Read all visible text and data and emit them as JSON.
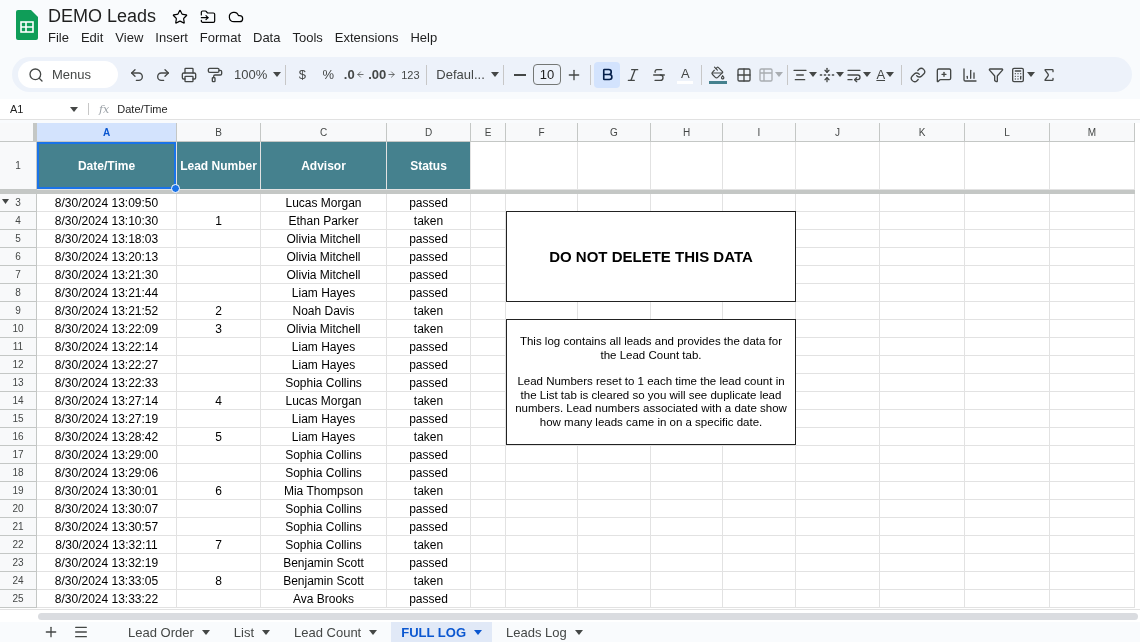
{
  "document": {
    "title": "DEMO Leads"
  },
  "menu": [
    "File",
    "Edit",
    "View",
    "Insert",
    "Format",
    "Data",
    "Tools",
    "Extensions",
    "Help"
  ],
  "toolbar": {
    "search_placeholder": "Menus",
    "zoom": "100%",
    "currency": "$",
    "percent": "%",
    "decrease_decimal": ".0",
    "increase_decimal": ".00",
    "number_format": "123",
    "font": "Defaul...",
    "font_size": "10",
    "bold_selected": true,
    "text_color_glyph": "A",
    "text_rotation_glyph": "A"
  },
  "function_glyph": "fx",
  "name_box": "A1",
  "formula": "Date/Time",
  "columns": [
    {
      "label": "A",
      "selected": true
    },
    {
      "label": "B",
      "selected": false
    },
    {
      "label": "C",
      "selected": false
    },
    {
      "label": "D",
      "selected": false
    },
    {
      "label": "E",
      "selected": false
    },
    {
      "label": "F",
      "selected": false
    },
    {
      "label": "G",
      "selected": false
    },
    {
      "label": "H",
      "selected": false
    },
    {
      "label": "I",
      "selected": false
    },
    {
      "label": "J",
      "selected": false
    },
    {
      "label": "K",
      "selected": false
    },
    {
      "label": "L",
      "selected": false
    },
    {
      "label": "M",
      "selected": false
    }
  ],
  "header_row": {
    "number": "1",
    "cells": [
      "Date/Time",
      "Lead Number",
      "Advisor",
      "Status"
    ]
  },
  "rows": [
    {
      "number": "3",
      "date": "8/30/2024 13:09:50",
      "advisor": "Lucas Morgan",
      "status": "passed"
    },
    {
      "number": "4",
      "date": "8/30/2024 13:10:30",
      "lead": "1",
      "advisor": "Ethan Parker",
      "status": "taken"
    },
    {
      "number": "5",
      "date": "8/30/2024 13:18:03",
      "advisor": "Olivia Mitchell",
      "status": "passed"
    },
    {
      "number": "6",
      "date": "8/30/2024 13:20:13",
      "advisor": "Olivia Mitchell",
      "status": "passed"
    },
    {
      "number": "7",
      "date": "8/30/2024 13:21:30",
      "advisor": "Olivia Mitchell",
      "status": "passed"
    },
    {
      "number": "8",
      "date": "8/30/2024 13:21:44",
      "advisor": "Liam Hayes",
      "status": "passed"
    },
    {
      "number": "9",
      "date": "8/30/2024 13:21:52",
      "lead": "2",
      "advisor": "Noah Davis",
      "status": "taken"
    },
    {
      "number": "10",
      "date": "8/30/2024 13:22:09",
      "lead": "3",
      "advisor": "Olivia Mitchell",
      "status": "taken"
    },
    {
      "number": "11",
      "date": "8/30/2024 13:22:14",
      "advisor": "Liam Hayes",
      "status": "passed"
    },
    {
      "number": "12",
      "date": "8/30/2024 13:22:27",
      "advisor": "Liam Hayes",
      "status": "passed"
    },
    {
      "number": "13",
      "date": "8/30/2024 13:22:33",
      "advisor": "Sophia Collins",
      "status": "passed"
    },
    {
      "number": "14",
      "date": "8/30/2024 13:27:14",
      "lead": "4",
      "advisor": "Lucas Morgan",
      "status": "taken"
    },
    {
      "number": "15",
      "date": "8/30/2024 13:27:19",
      "advisor": "Liam Hayes",
      "status": "passed"
    },
    {
      "number": "16",
      "date": "8/30/2024 13:28:42",
      "lead": "5",
      "advisor": "Liam Hayes",
      "status": "taken"
    },
    {
      "number": "17",
      "date": "8/30/2024 13:29:00",
      "advisor": "Sophia Collins",
      "status": "passed"
    },
    {
      "number": "18",
      "date": "8/30/2024 13:29:06",
      "advisor": "Sophia Collins",
      "status": "passed"
    },
    {
      "number": "19",
      "date": "8/30/2024 13:30:01",
      "lead": "6",
      "advisor": "Mia Thompson",
      "status": "taken"
    },
    {
      "number": "20",
      "date": "8/30/2024 13:30:07",
      "advisor": "Sophia Collins",
      "status": "passed"
    },
    {
      "number": "21",
      "date": "8/30/2024 13:30:57",
      "advisor": "Sophia Collins",
      "status": "passed"
    },
    {
      "number": "22",
      "date": "8/30/2024 13:32:11",
      "lead": "7",
      "advisor": "Sophia Collins",
      "status": "taken"
    },
    {
      "number": "23",
      "date": "8/30/2024 13:32:19",
      "advisor": "Benjamin Scott",
      "status": "passed"
    },
    {
      "number": "24",
      "date": "8/30/2024 13:33:05",
      "lead": "8",
      "advisor": "Benjamin Scott",
      "status": "taken"
    },
    {
      "number": "25",
      "date": "8/30/2024 13:33:22",
      "advisor": "Ava Brooks",
      "status": "passed"
    }
  ],
  "notes": [
    {
      "kind": "warning",
      "paragraphs": [
        "DO NOT DELETE THIS DATA"
      ]
    },
    {
      "kind": "info",
      "paragraphs": [
        "This log contains all leads and provides the data for the Lead Count tab.",
        "Lead Numbers reset to 1 each time the lead count in the List tab is cleared so you will see duplicate lead numbers. Lead numbers associated with a date show how many leads came in on a specific date."
      ]
    }
  ],
  "sheet_tabs": [
    {
      "label": "Lead Order",
      "selected": false
    },
    {
      "label": "List",
      "selected": false
    },
    {
      "label": "Lead Count",
      "selected": false
    },
    {
      "label": "FULL LOG",
      "selected": true
    },
    {
      "label": "Leads Log",
      "selected": false
    }
  ]
}
